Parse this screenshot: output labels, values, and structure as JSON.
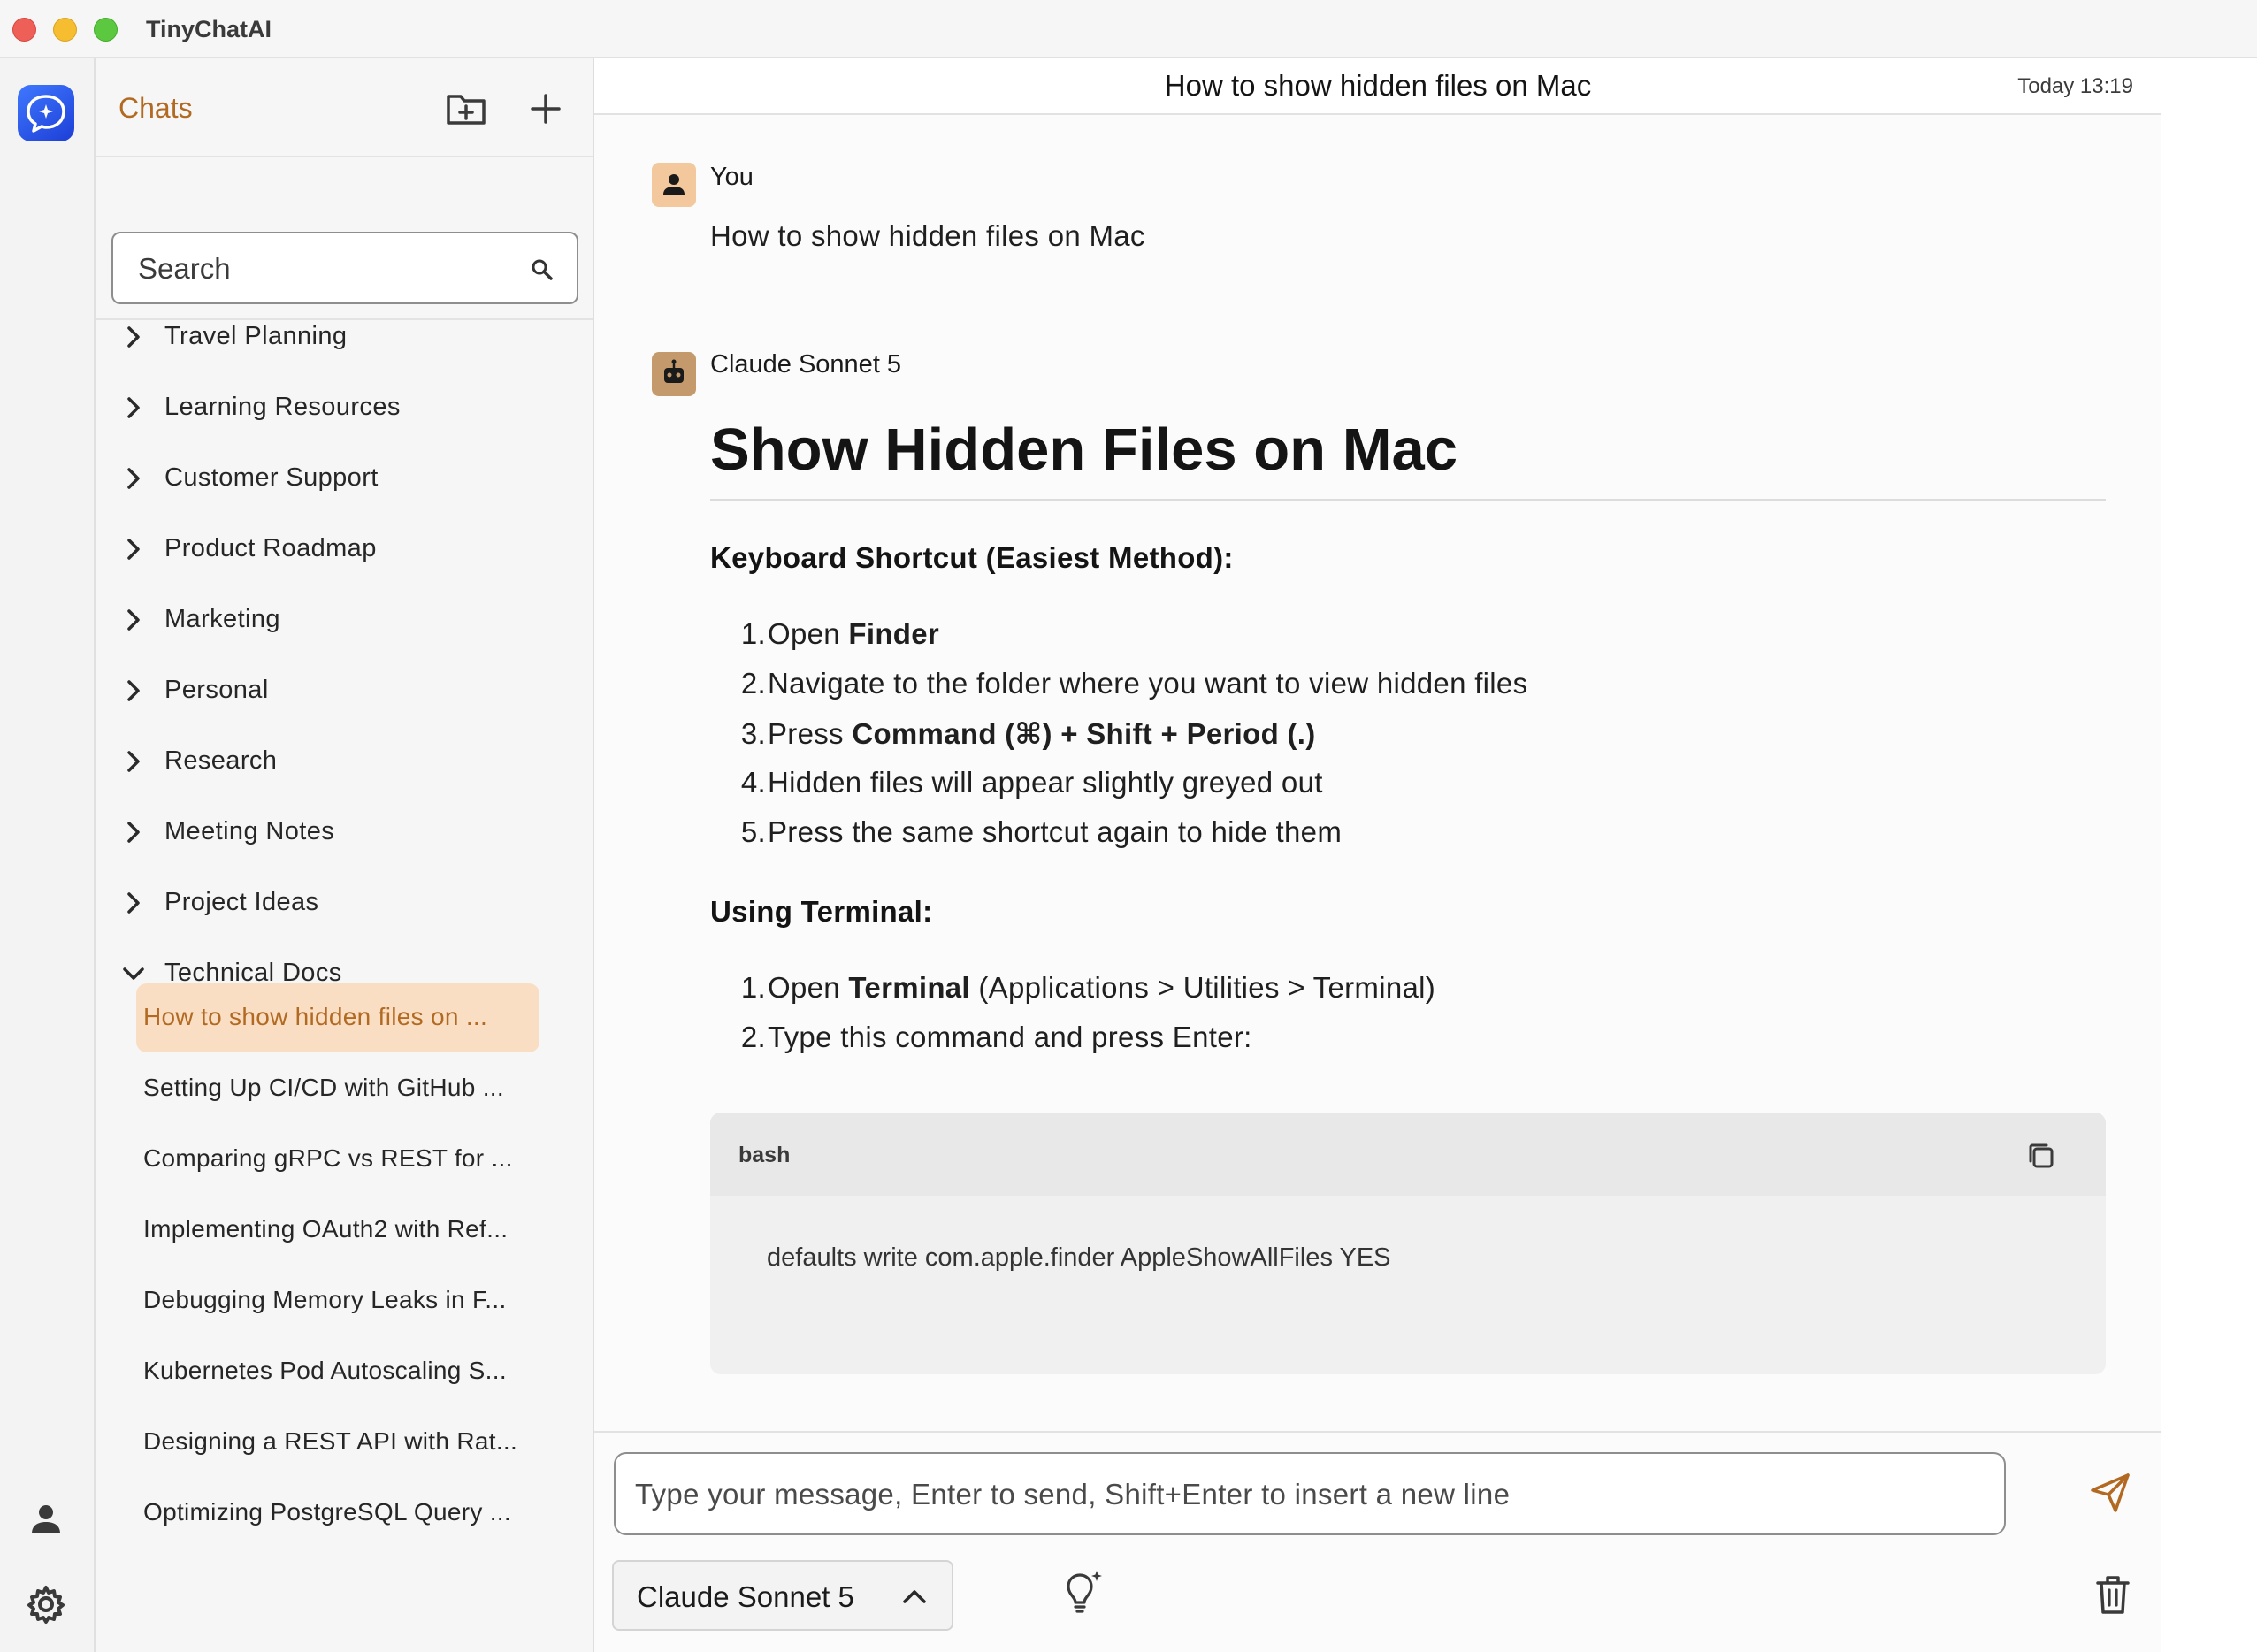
{
  "window": {
    "app_title": "TinyChatAI"
  },
  "sidebar": {
    "title": "Chats",
    "search": {
      "placeholder": "Search"
    },
    "folders": [
      {
        "label": "Travel Planning",
        "expanded": false
      },
      {
        "label": "Learning Resources",
        "expanded": false
      },
      {
        "label": "Customer Support",
        "expanded": false
      },
      {
        "label": "Product Roadmap",
        "expanded": false
      },
      {
        "label": "Marketing",
        "expanded": false
      },
      {
        "label": "Personal",
        "expanded": false
      },
      {
        "label": "Research",
        "expanded": false
      },
      {
        "label": "Meeting Notes",
        "expanded": false
      },
      {
        "label": "Project Ideas",
        "expanded": false
      },
      {
        "label": "Technical Docs",
        "expanded": true
      }
    ],
    "chats": [
      {
        "label": "How to show hidden files on ...",
        "active": true
      },
      {
        "label": "Setting Up CI/CD with GitHub ...",
        "active": false
      },
      {
        "label": "Comparing gRPC vs REST for ...",
        "active": false
      },
      {
        "label": "Implementing OAuth2 with Ref...",
        "active": false
      },
      {
        "label": "Debugging Memory Leaks in F...",
        "active": false
      },
      {
        "label": "Kubernetes Pod Autoscaling S...",
        "active": false
      },
      {
        "label": "Designing a REST API with Rat...",
        "active": false
      },
      {
        "label": "Optimizing PostgreSQL Query ...",
        "active": false
      }
    ]
  },
  "chat": {
    "title": "How to show hidden files on Mac",
    "timestamp": "Today 13:19",
    "user": {
      "sender": "You",
      "message": "How to show hidden files on Mac"
    },
    "assistant": {
      "sender": "Claude Sonnet 5",
      "heading": "Show Hidden Files on Mac",
      "section1_title": "Keyboard Shortcut (Easiest Method):",
      "section1_items": [
        {
          "num": "1.",
          "pre": "Open ",
          "bold": "Finder",
          "post": ""
        },
        {
          "num": "2.",
          "pre": "Navigate to the folder where you want to view hidden files",
          "bold": "",
          "post": ""
        },
        {
          "num": "3.",
          "pre": "Press ",
          "bold": "Command (⌘) + Shift + Period (.)",
          "post": ""
        },
        {
          "num": "4.",
          "pre": "Hidden files will appear slightly greyed out",
          "bold": "",
          "post": ""
        },
        {
          "num": "5.",
          "pre": "Press the same shortcut again to hide them",
          "bold": "",
          "post": ""
        }
      ],
      "section2_title": "Using Terminal:",
      "section2_items": [
        {
          "num": "1.",
          "pre": "Open ",
          "bold": "Terminal",
          "post": " (Applications > Utilities > Terminal)"
        },
        {
          "num": "2.",
          "pre": "Type this command and press Enter:",
          "bold": "",
          "post": ""
        }
      ],
      "code": {
        "language": "bash",
        "content": "defaults write com.apple.finder AppleShowAllFiles YES"
      }
    }
  },
  "composer": {
    "placeholder": "Type your message, Enter to send, Shift+Enter to insert a new line",
    "model": "Claude Sonnet 5"
  },
  "colors": {
    "accent": "#b26a22",
    "active_chat_bg": "#f9dec4",
    "logo_blue": "#2f5cf0"
  },
  "icons": {
    "new_folder": "folder-plus-icon",
    "new_chat": "plus-icon",
    "search": "search-icon",
    "user": "person-icon",
    "settings": "gear-icon",
    "copy": "copy-icon",
    "send": "send-icon",
    "bulb": "lightbulb-sparkle-icon",
    "trash": "trash-icon"
  }
}
